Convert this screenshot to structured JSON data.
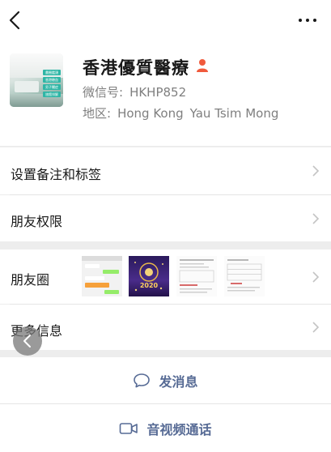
{
  "header": {
    "back_icon": "chevron-left-icon",
    "more_icon": "more-dots-icon"
  },
  "profile": {
    "name": "香港優質醫療",
    "badge_icon": "person-icon",
    "badge_color": "#f05a3c",
    "wechat_id_label": "微信号:",
    "wechat_id": "HKHP852",
    "region_label": "地区:",
    "region_city": "Hong Kong",
    "region_district": "Yau Tsim Mong",
    "avatar_tags": [
      "畫圈鑑頭",
      "香港驗血",
      "男子閹症",
      "旅館排解"
    ]
  },
  "menu": {
    "set_remark": "设置备注和标签",
    "friend_permissions": "朋友权限",
    "moments": "朋友圈",
    "more_info": "更多信息"
  },
  "moments_thumbs": {
    "t2_year": "2020"
  },
  "actions": {
    "send_message": "发消息",
    "video_call": "音视频通话"
  },
  "colors": {
    "accent": "#576b95",
    "background": "#ededed"
  }
}
